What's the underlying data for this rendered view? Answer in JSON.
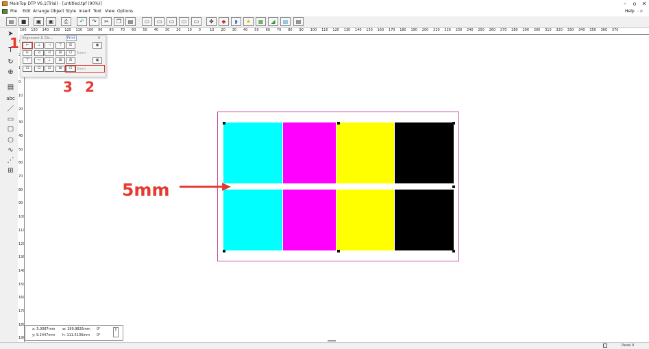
{
  "window": {
    "title": "MainTop DTP V6.1(Trial) - [untitled.tpf (90%)]",
    "minimize": "–",
    "maximize": "o",
    "close": "✕",
    "restore": "- ø"
  },
  "menu": {
    "items": [
      "File",
      "Edit",
      "Arrange",
      "Object",
      "Style",
      "Insert",
      "Tool",
      "View",
      "Options"
    ],
    "help": "Help"
  },
  "toolbar": {
    "buttons": [
      "open-icon",
      "save-icon",
      "import-icon",
      "export-icon",
      "print-icon",
      "undo-icon",
      "redo-icon",
      "cut-icon",
      "copy-icon",
      "paste-icon",
      "frame-icon",
      "frame2-icon",
      "frame3-icon",
      "frame4-icon",
      "frame5-icon",
      "move-icon",
      "color-icon",
      "paint-icon",
      "star-icon",
      "image-icon",
      "chart-icon",
      "photo-icon",
      "preview-icon"
    ]
  },
  "ruler": {
    "horizontal": [
      "160",
      "150",
      "140",
      "130",
      "120",
      "110",
      "100",
      "90",
      "80",
      "70",
      "60",
      "50",
      "40",
      "30",
      "20",
      "10",
      "0",
      "10",
      "20",
      "30",
      "40",
      "50",
      "60",
      "70",
      "80",
      "90",
      "100",
      "110",
      "120",
      "130",
      "140",
      "150",
      "160",
      "170",
      "180",
      "190",
      "200",
      "210",
      "220",
      "230",
      "240",
      "250",
      "260",
      "270",
      "280",
      "290",
      "300",
      "310",
      "320",
      "330",
      "340",
      "350",
      "360",
      "370"
    ],
    "vertical": [
      "30",
      "20",
      "10",
      "0",
      "10",
      "20",
      "30",
      "40",
      "50",
      "60",
      "70",
      "80",
      "90",
      "100",
      "110",
      "120",
      "130",
      "140",
      "150",
      "160",
      "170",
      "180",
      "190"
    ]
  },
  "dialog": {
    "tab1": "Alignment & Dis...",
    "tab2": "Print",
    "close": "×",
    "spacing1": "5mm",
    "spacing2": "5mm"
  },
  "annotations": {
    "num1": "1",
    "num3": "3",
    "num2": "2",
    "gap_label": "5mm",
    "color": "#e43a2f"
  },
  "swatches": {
    "colors": [
      "#00ffff",
      "#ff00ff",
      "#ffff00",
      "#000000"
    ]
  },
  "status": {
    "x": "x: 5.0087mm",
    "y": "y: 9.2447mm",
    "w": "w: 199.9826mm",
    "h": "h: 111.5106mm",
    "rot": "0°",
    "skew": "0°",
    "right": "Panel 0"
  }
}
